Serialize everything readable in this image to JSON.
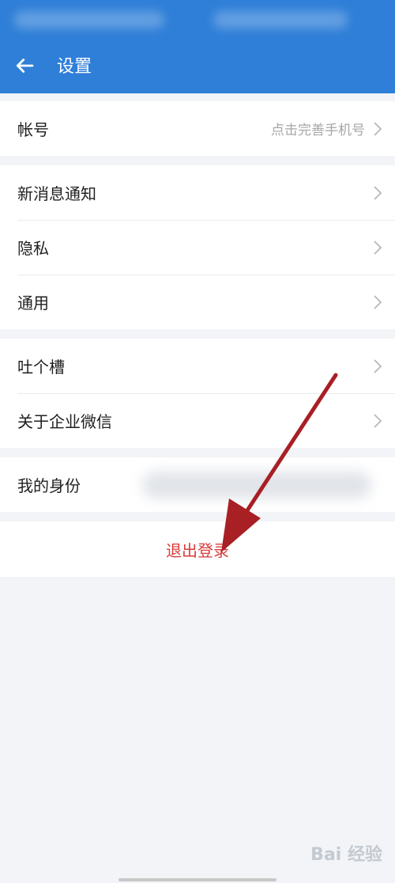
{
  "header": {
    "title": "设置",
    "back_icon": "arrow-left-icon",
    "color": "#2f7fd8"
  },
  "sections": [
    {
      "rows": [
        {
          "label": "帐号",
          "value": "点击完善手机号"
        }
      ]
    },
    {
      "rows": [
        {
          "label": "新消息通知"
        },
        {
          "label": "隐私"
        },
        {
          "label": "通用"
        }
      ]
    },
    {
      "rows": [
        {
          "label": "吐个槽"
        },
        {
          "label": "关于企业微信"
        }
      ]
    },
    {
      "rows": [
        {
          "label": "我的身份"
        }
      ]
    }
  ],
  "logout": {
    "label": "退出登录",
    "color": "#d93a3a"
  },
  "watermark": {
    "text": "Bai 经验"
  }
}
